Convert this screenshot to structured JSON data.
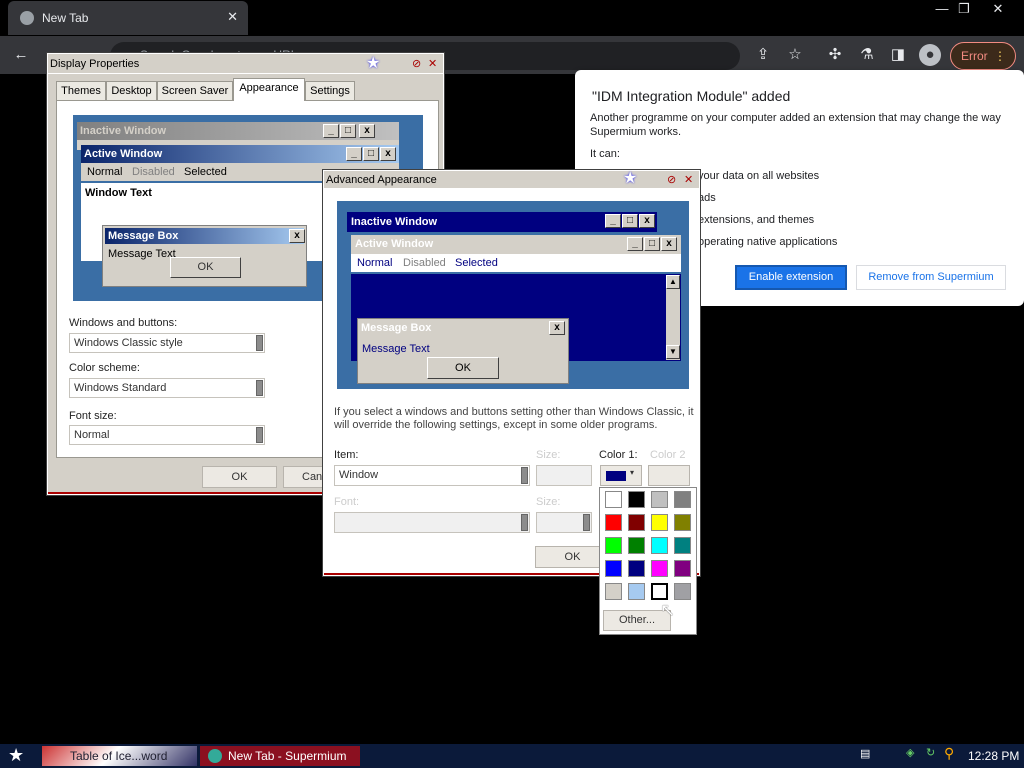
{
  "browser": {
    "tab_title": "New Tab",
    "tab_close": "✕",
    "omnibox_text": "Search Google or type a URL",
    "error_label": "Error",
    "menu_dots": "⋮",
    "window_controls": [
      "—",
      "❐",
      "✕"
    ]
  },
  "extension_popup": {
    "title": "\"IDM Integration Module\" added",
    "description": "Another programme on your computer added an extension that may change the way Supermium works.",
    "it_can": "It can:",
    "permissions": [
      "your data on all websites",
      "ads",
      "extensions, and themes",
      "operating native applications"
    ],
    "enable_button": "Enable extension",
    "remove_button": "Remove from Supermium"
  },
  "display_properties": {
    "title": "Display Properties",
    "tabs": [
      "Themes",
      "Desktop",
      "Screen Saver",
      "Appearance",
      "Settings"
    ],
    "active_tab": "Appearance",
    "preview": {
      "inactive_window": "Inactive Window",
      "active_window": "Active Window",
      "menu_normal": "Normal",
      "menu_disabled": "Disabled",
      "menu_selected": "Selected",
      "window_text": "Window Text",
      "message_box": "Message Box",
      "message_text": "Message Text",
      "ok": "OK"
    },
    "windows_and_buttons_label": "Windows and buttons:",
    "windows_and_buttons_value": "Windows Classic style",
    "color_scheme_label": "Color scheme:",
    "color_scheme_value": "Windows Standard",
    "font_size_label": "Font size:",
    "font_size_value": "Normal",
    "ok_button": "OK",
    "cancel_button": "Can"
  },
  "advanced_appearance": {
    "title": "Advanced Appearance",
    "preview": {
      "inactive_window": "Inactive Window",
      "active_window": "Active Window",
      "menu_normal": "Normal",
      "menu_disabled": "Disabled",
      "menu_selected": "Selected",
      "message_box": "Message Box",
      "message_text": "Message Text",
      "ok": "OK"
    },
    "info_text": "If you select a windows and buttons setting other than Windows Classic, it will override the following settings, except in some older programs.",
    "item_label": "Item:",
    "item_value": "Window",
    "size_label": "Size:",
    "color1_label": "Color 1:",
    "color2_label": "Color 2",
    "font_label": "Font:",
    "size2_label": "Size:",
    "ok_button": "OK",
    "color1_value": "#000080"
  },
  "palette": {
    "colors": [
      "#ffffff",
      "#000000",
      "#c0c0c0",
      "#808080",
      "#ff0000",
      "#800000",
      "#ffff00",
      "#808000",
      "#00ff00",
      "#008000",
      "#00ffff",
      "#008080",
      "#0000ff",
      "#000080",
      "#ff00ff",
      "#800080",
      "#d4d0c8",
      "#a6caf0",
      "#ffffff",
      "#a0a0a4"
    ],
    "selected_index": 18,
    "other_button": "Other..."
  },
  "taskbar": {
    "task1": "Table of Ice...word",
    "task2": "New Tab - Supermium",
    "clock": "12:28 PM"
  }
}
